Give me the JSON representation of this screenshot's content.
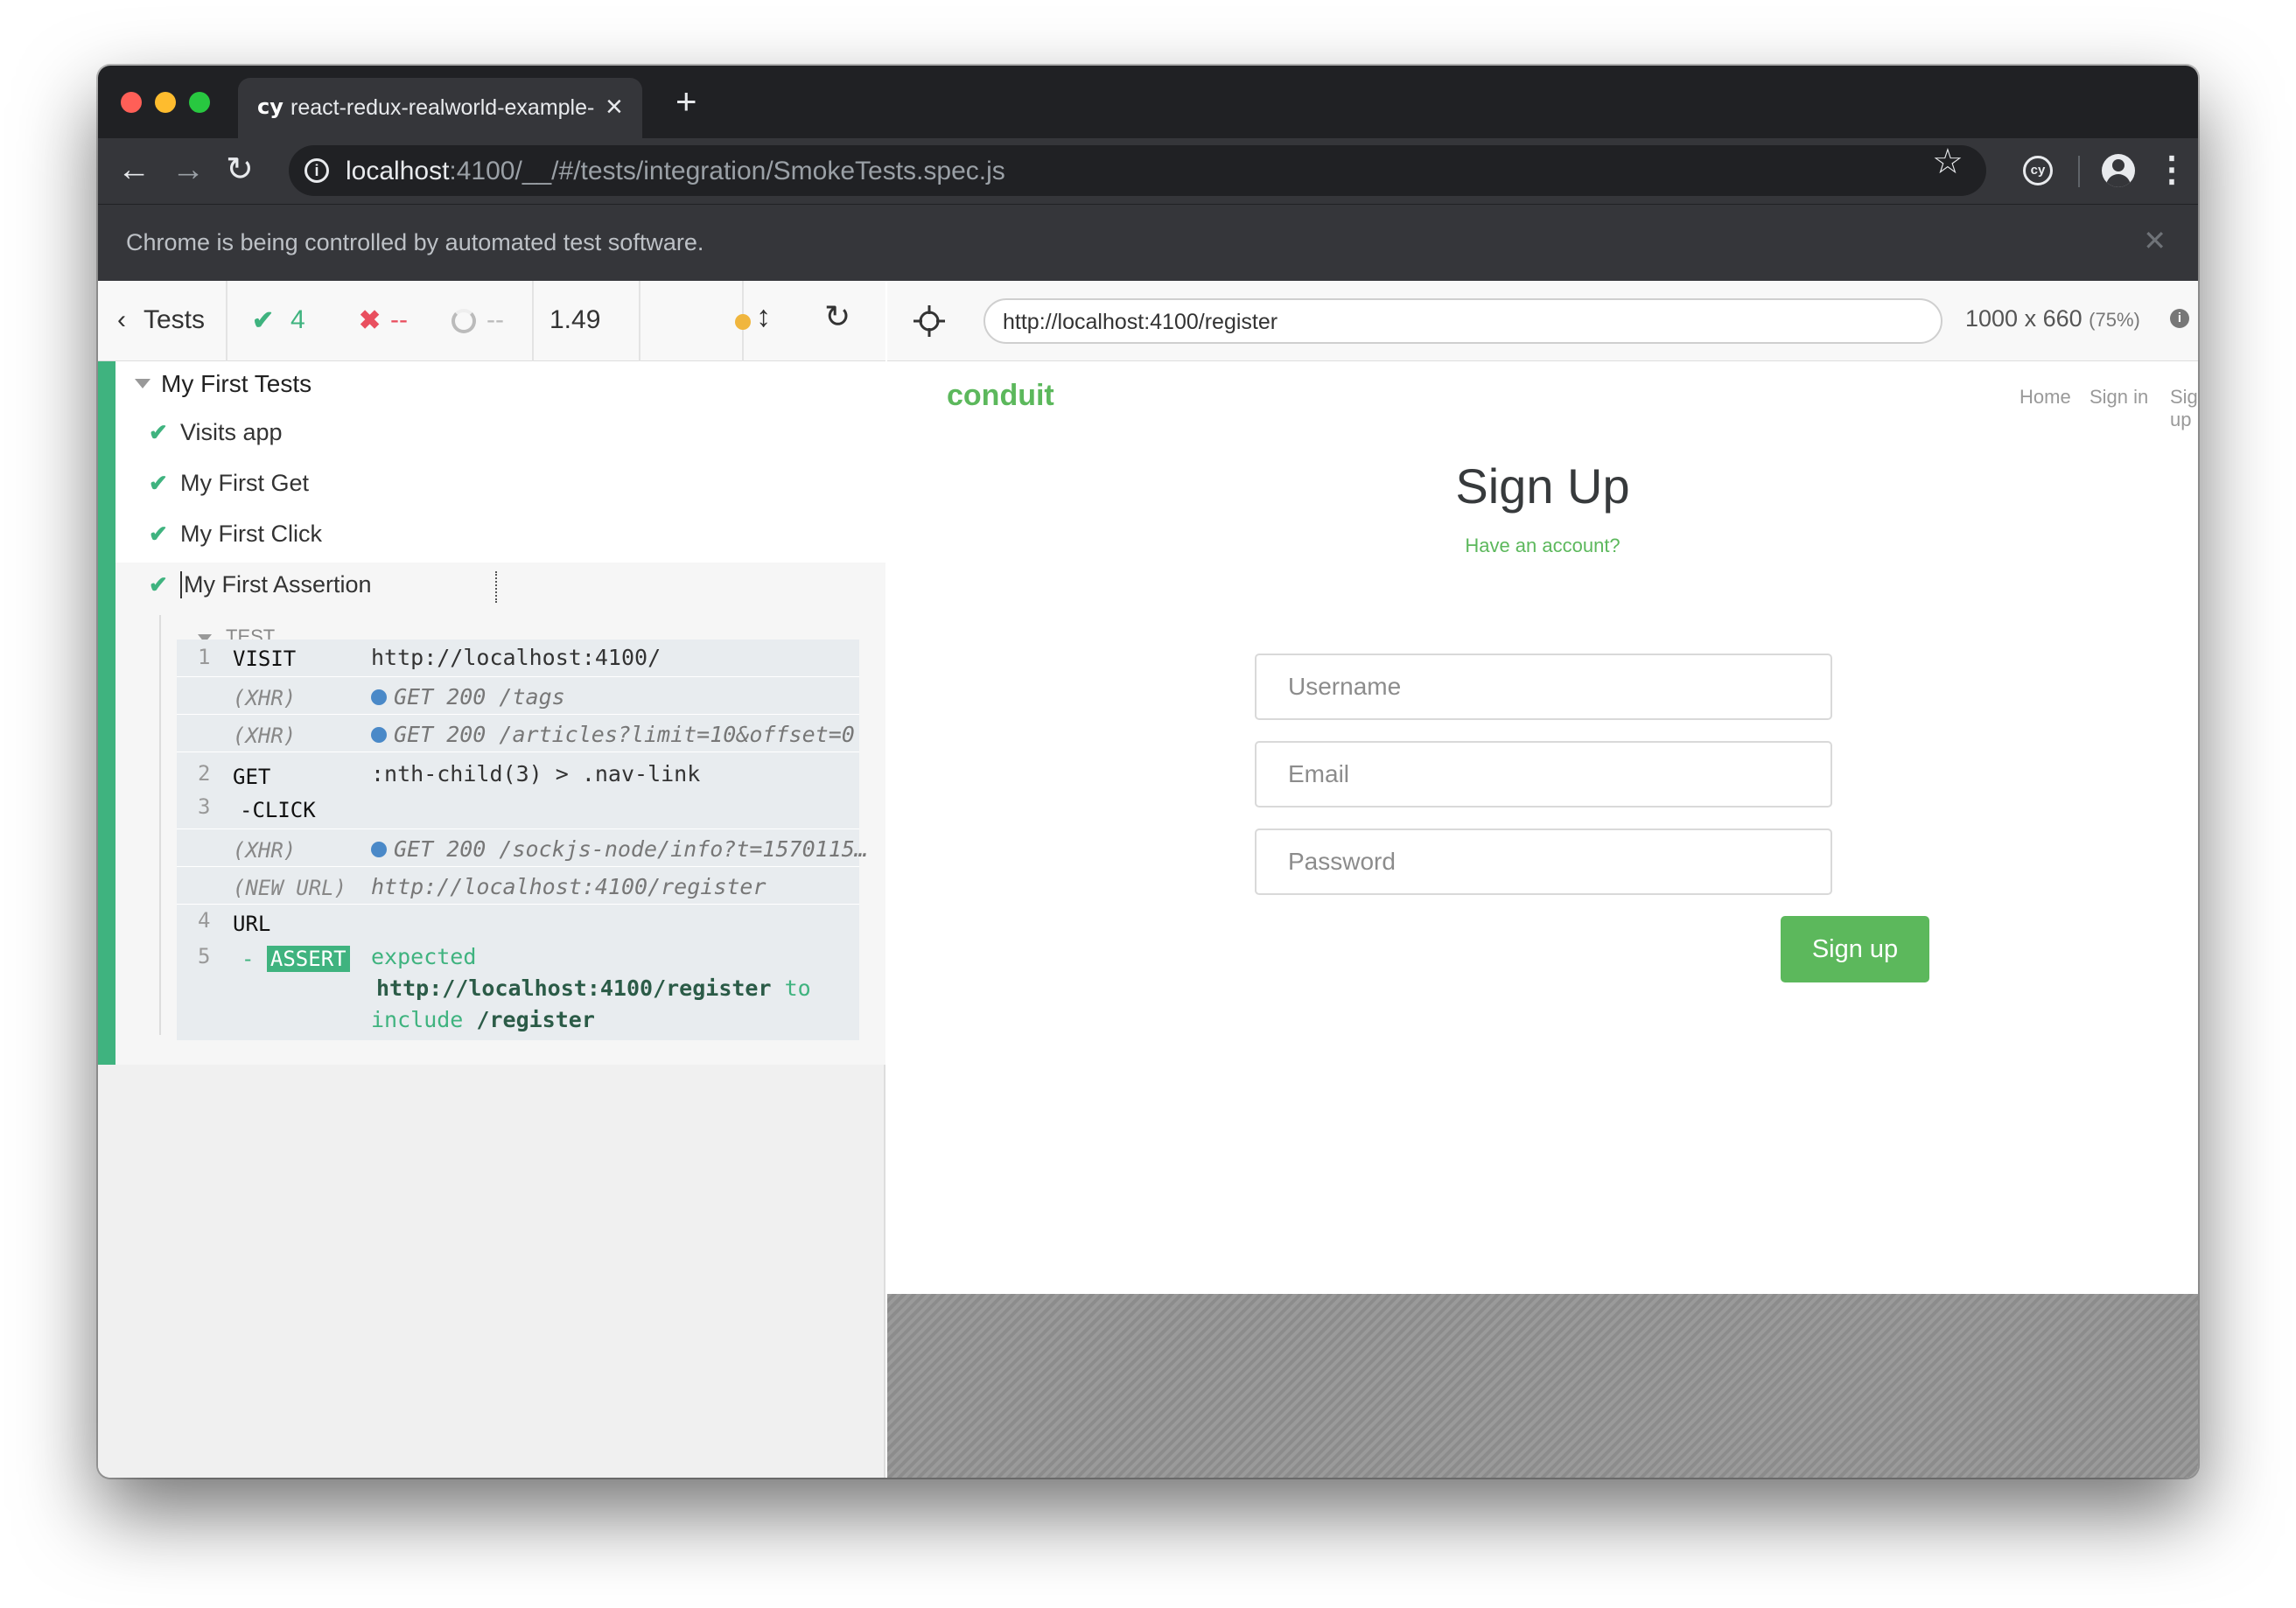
{
  "browser": {
    "tab_title": "react-redux-realworld-example-app",
    "tab_favicon": "cy",
    "url_host": "localhost",
    "url_rest": ":4100/__/#/tests/integration/SmokeTests.spec.js",
    "extension_label": "cy",
    "automation_message": "Chrome is being controlled by automated test software."
  },
  "reporter": {
    "back_label": "Tests",
    "passed": "4",
    "failed": "--",
    "pending": "--",
    "duration": "1.49",
    "suite_title": "My First Tests",
    "tests": [
      {
        "title": "Visits app",
        "state": "passed"
      },
      {
        "title": "My First Get",
        "state": "passed"
      },
      {
        "title": "My First Click",
        "state": "passed"
      },
      {
        "title": "My First Assertion",
        "state": "passed"
      }
    ],
    "hook_label": "TEST",
    "commands": [
      {
        "num": "1",
        "name": "VISIT",
        "message": "http://localhost:4100/"
      },
      {
        "num": "",
        "name": "(XHR)",
        "message": "GET 200 /tags"
      },
      {
        "num": "",
        "name": "(XHR)",
        "message": "GET 200 /articles?limit=10&offset=0"
      },
      {
        "num": "2",
        "name": "GET",
        "message": ":nth-child(3) > .nav-link"
      },
      {
        "num": "3",
        "name": "-CLICK",
        "message": ""
      },
      {
        "num": "",
        "name": "(XHR)",
        "message": "GET 200 /sockjs-node/info?t=1570115…"
      },
      {
        "num": "",
        "name": "(NEW URL)",
        "message": "http://localhost:4100/register"
      },
      {
        "num": "4",
        "name": "URL",
        "message": ""
      },
      {
        "num": "5",
        "name": "ASSERT",
        "name_prefix": "-",
        "message_parts": {
          "expected": "expected",
          "actual": "http://localhost:4100/register",
          "to": "to",
          "include": "include",
          "value": "/register"
        }
      }
    ]
  },
  "aut": {
    "url": "http://localhost:4100/register",
    "viewport": "1000 x 660",
    "zoom": "(75%)"
  },
  "app": {
    "logo": "conduit",
    "nav": [
      "Home",
      "Sign in",
      "Sign up"
    ],
    "title": "Sign Up",
    "have_account": "Have an account?",
    "username_placeholder": "Username",
    "email_placeholder": "Email",
    "password_placeholder": "Password",
    "submit_label": "Sign up"
  },
  "colors": {
    "brand": "#5cb85c",
    "pass": "#3fb37f",
    "fail": "#e94f5f",
    "xhr_dot": "#4a89c8"
  }
}
